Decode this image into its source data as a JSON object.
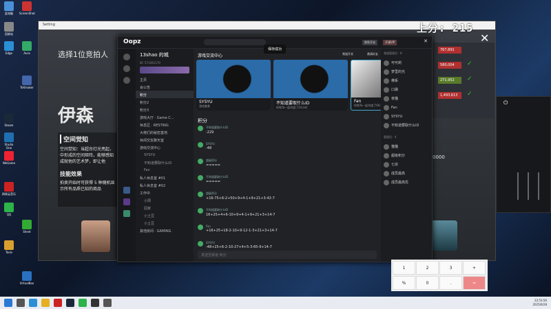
{
  "desktop": {
    "icons": [
      "此电脑",
      "回收站",
      "Edge",
      "Steam",
      "Studio One",
      "WeGame",
      "网易云音乐",
      "QQ",
      "ScreenShot",
      "Aura",
      "TeXmaker",
      "Sheet",
      "Tools",
      "VirtualBox"
    ]
  },
  "game_window": {
    "title": "Setting",
    "heading": "选择1位竞拍人",
    "big_name": "伊森",
    "section1_title": "空间觉知",
    "section1_body": "空间觉知：当超台灯光亮起，中形成的空间矩阵，能够感知成就他的艺术梦，即让他",
    "section2_title": "技能效果",
    "section2_body": "拍卖开始时可获得 5 种随机显示所有品质已知的商品",
    "number_label": "0000"
  },
  "score": {
    "label": "上分: 215"
  },
  "oopz": {
    "logo": "Oopz",
    "server_name": "13shao 的城",
    "server_id": "ID: 571261170",
    "channel_header": "游戏交流中心",
    "save_toast": "保存成功",
    "top_buttons": [
      "限免开启",
      "开通VIP"
    ],
    "side_actions": [
      "频道开关",
      "邀请好友"
    ],
    "channels": [
      {
        "label": "主页",
        "sub": false
      },
      {
        "label": "会公告",
        "sub": false
      },
      {
        "label": "积分",
        "sub": false,
        "active": true
      },
      {
        "label": "积分2",
        "sub": false
      },
      {
        "label": "积分3",
        "sub": false
      },
      {
        "label": "游戏大厅 · Game C...",
        "sub": false
      },
      {
        "label": "休息区 · RESTING",
        "sub": false
      },
      {
        "label": "大佬们的秘密基地",
        "sub": false
      },
      {
        "label": "休闲交友聊天室",
        "sub": false
      },
      {
        "label": "游戏交流中心",
        "sub": false
      },
      {
        "label": "SYSYU",
        "sub": true
      },
      {
        "label": "不知道要取什么ID",
        "sub": true
      },
      {
        "label": "Fan",
        "sub": true
      },
      {
        "label": "私人休息室 #01",
        "sub": false
      },
      {
        "label": "私人休息室 #02",
        "sub": false
      },
      {
        "label": "工作中",
        "sub": false
      },
      {
        "label": "小周",
        "sub": true
      },
      {
        "label": "回家",
        "sub": true
      },
      {
        "label": "小土豆",
        "sub": true
      },
      {
        "label": "小土豆",
        "sub": true
      },
      {
        "label": "其他房间 · GAMING",
        "sub": false
      }
    ],
    "voice_cards": [
      {
        "name": "SYSYU",
        "sub": "游戏美食"
      },
      {
        "name": "不知道要取什么ID",
        "sub": "你和Ta一起共度了24小时"
      },
      {
        "name": "Fan",
        "sub": "你和Ta一起共度了60小时"
      }
    ],
    "chat_title": "积分",
    "messages": [
      {
        "name": "不知道要取什么ID",
        "body": "-229"
      },
      {
        "name": "SYSYU",
        "body": "-48"
      },
      {
        "name": "超级积分",
        "body": "====="
      },
      {
        "name": "不知道要取什么ID",
        "body": "====="
      },
      {
        "name": "超级积分",
        "body": "+16-75+6-2+50+9+4-1+9+21+3-42-7"
      },
      {
        "name": "不知道要取什么ID",
        "body": "16+25+4+6-10+9+4-1+9+21+3+14-7"
      },
      {
        "name": "Fan",
        "body": "+16+25+18-2-10+9-12-1-3+21+3+14-7"
      },
      {
        "name": "SYSYU",
        "body": "-48+25+6-2-10-27+4+5-3-65-9+14-7"
      }
    ],
    "input_placeholder": "发送至频道 积分",
    "members_header": "频道管理员 - 8",
    "members": [
      "可可莉",
      "梦里的光",
      "佛系",
      "口袋",
      "夜猫",
      "Fan",
      "SYSYU",
      "不知道要取什么ID"
    ],
    "members_header2": "管理员 - 4",
    "members2": [
      "猫猫",
      "超级积分",
      "七宗",
      "成员最高",
      "成员最高优"
    ]
  },
  "rpanel": {
    "rows": [
      "767,891",
      "580,004",
      "271,952",
      "1,493,613"
    ]
  },
  "calculator": {
    "keys": [
      "1",
      "2",
      "3",
      "+",
      "%",
      "0",
      ".",
      "="
    ]
  },
  "clock": {
    "time": "22:53:56",
    "date": "2025/6/28"
  }
}
